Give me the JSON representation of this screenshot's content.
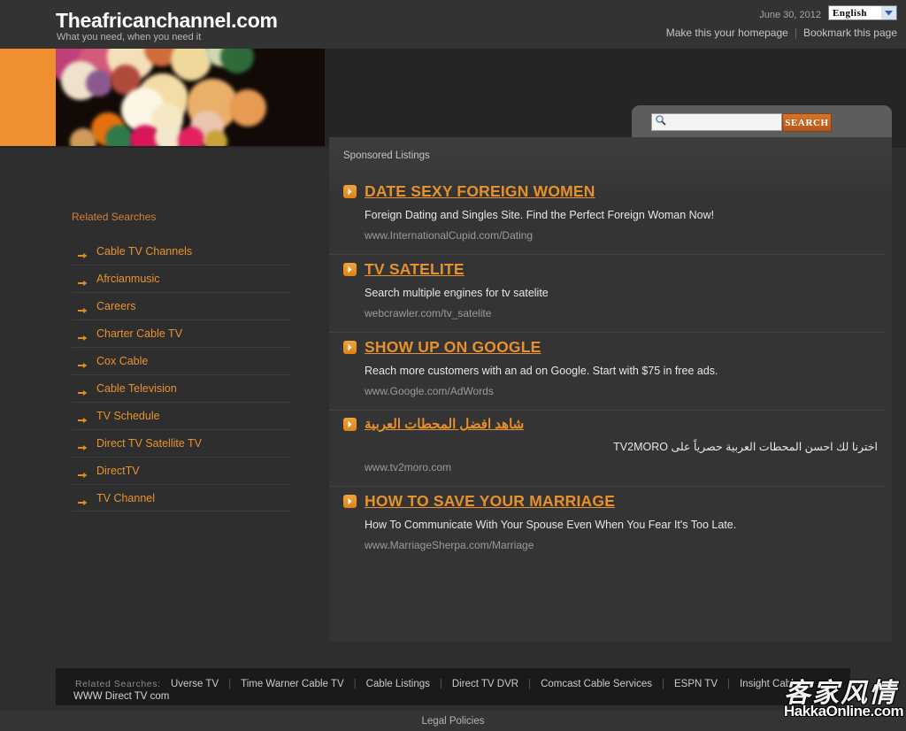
{
  "header": {
    "title": "Theafricanchannel.com",
    "tagline": "What you need, when you need it",
    "date": "June 30, 2012",
    "language_selected": "English",
    "homepage_link": "Make this your homepage",
    "separator": "|",
    "bookmark_link": "Bookmark this page"
  },
  "search": {
    "value": "",
    "placeholder": "",
    "button_label": "SEARCH"
  },
  "sidebar": {
    "heading": "Related Searches",
    "items": [
      {
        "label": "Cable TV Channels"
      },
      {
        "label": "Afrcianmusic"
      },
      {
        "label": "Careers"
      },
      {
        "label": "Charter Cable TV"
      },
      {
        "label": "Cox Cable"
      },
      {
        "label": "Cable Television"
      },
      {
        "label": "TV Schedule"
      },
      {
        "label": "Direct TV Satellite TV"
      },
      {
        "label": "DirectTV"
      },
      {
        "label": "TV Channel"
      }
    ]
  },
  "ads": {
    "section_label": "Sponsored Listings",
    "items": [
      {
        "title": "DATE SEXY FOREIGN WOMEN",
        "description": "Foreign Dating and Singles Site. Find the Perfect Foreign Woman Now!",
        "url": "www.InternationalCupid.com/Dating",
        "rtl": false
      },
      {
        "title": "TV SATELITE",
        "description": "Search multiple engines for tv satelite",
        "url": "webcrawler.com/tv_satelite",
        "rtl": false
      },
      {
        "title": "SHOW UP ON GOOGLE",
        "description": "Reach more customers with an ad on Google. Start with $75 in free ads.",
        "url": "www.Google.com/AdWords",
        "rtl": false
      },
      {
        "title": "شاهد افضل المحطات العربية",
        "description": "اخترنا لك احسن المحطات العربية حصرياً على TV2MORO",
        "url": "www.tv2moro.com",
        "rtl": true
      },
      {
        "title": "HOW TO SAVE YOUR MARRIAGE",
        "description": "How To Communicate With Your Spouse Even When You Fear It's Too Late.",
        "url": "www.MarriageSherpa.com/Marriage",
        "rtl": false
      }
    ]
  },
  "footer": {
    "related_label": "Related Searches:",
    "related_sub": "WWW Direct TV com",
    "separator": "|",
    "links": [
      {
        "label": "Uverse TV"
      },
      {
        "label": "Time Warner Cable TV"
      },
      {
        "label": "Cable Listings"
      },
      {
        "label": "Direct TV DVR"
      },
      {
        "label": "Comcast Cable Services"
      },
      {
        "label": "ESPN TV"
      },
      {
        "label": "Insight Cable"
      }
    ],
    "legal_link": "Legal Policies"
  },
  "watermark": {
    "chinese": "客家风情",
    "english": "HakkaOnline.com"
  },
  "colors": {
    "accent_orange": "#e8932f",
    "page_background": "#2e2e2e",
    "panel_background": "#343434",
    "header_background": "#333333",
    "footer_background": "#1a1a1a"
  }
}
